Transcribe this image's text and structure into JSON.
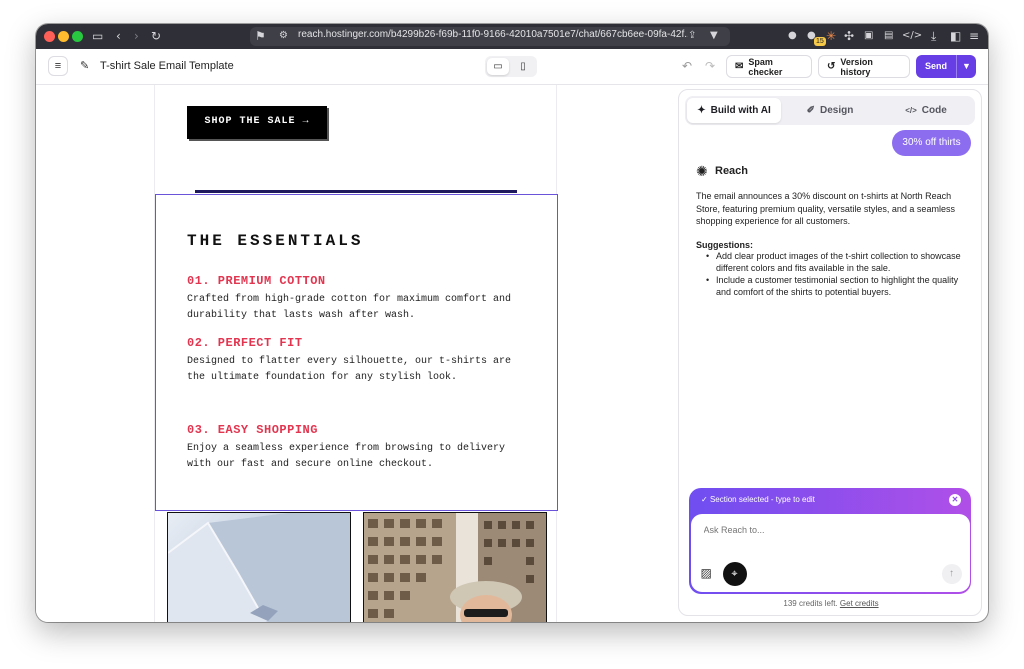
{
  "browser": {
    "url": "reach.hostinger.com/b4299b26-f69b-11f0-9166-42010a7501e7/chat/667cb6ee-09fa-42f...",
    "extension_badge": "15"
  },
  "toolbar": {
    "doc_title": "T-shirt Sale Email Template",
    "spam_checker_label": "Spam checker",
    "version_history_label": "Version history",
    "send_label": "Send"
  },
  "email": {
    "shop_button": "SHOP THE SALE →",
    "section_title": "THE ESSENTIALS",
    "features": [
      {
        "title": "01. PREMIUM COTTON",
        "desc": "Crafted from high-grade cotton for maximum comfort and durability that lasts wash after wash."
      },
      {
        "title": "02. PERFECT FIT",
        "desc": "Designed to flatter every silhouette, our t-shirts are the ultimate foundation for any stylish look."
      },
      {
        "title": "03. EASY SHOPPING",
        "desc": "Enjoy a seamless experience from browsing to delivery with our fast and secure online checkout."
      }
    ]
  },
  "panel": {
    "tabs": [
      {
        "label": "Build with AI",
        "icon": "sparkle-icon",
        "active": true
      },
      {
        "label": "Design",
        "icon": "brush-icon",
        "active": false
      },
      {
        "label": "Code",
        "icon": "code-icon",
        "active": false
      }
    ],
    "user_message": "30% off thirts",
    "assistant_name": "Reach",
    "assistant_text": "The email announces a 30% discount on t-shirts at North Reach Store, featuring premium quality, versatile styles, and a seamless shopping experience for all customers.",
    "suggestions_title": "Suggestions:",
    "suggestions": [
      "Add clear product images of the t-shirt collection to showcase different colors and fits available in the sale.",
      "Include a customer testimonial section to highlight the quality and comfort of the shirts to potential buyers."
    ],
    "composer_status": "Section selected - type to edit",
    "composer_placeholder": "Ask Reach to...",
    "credits_text": "139 credits left.",
    "credits_link": "Get credits"
  },
  "colors": {
    "accent": "#673de6",
    "feature_title": "#e2354f",
    "selection_border": "#6a52d9"
  }
}
